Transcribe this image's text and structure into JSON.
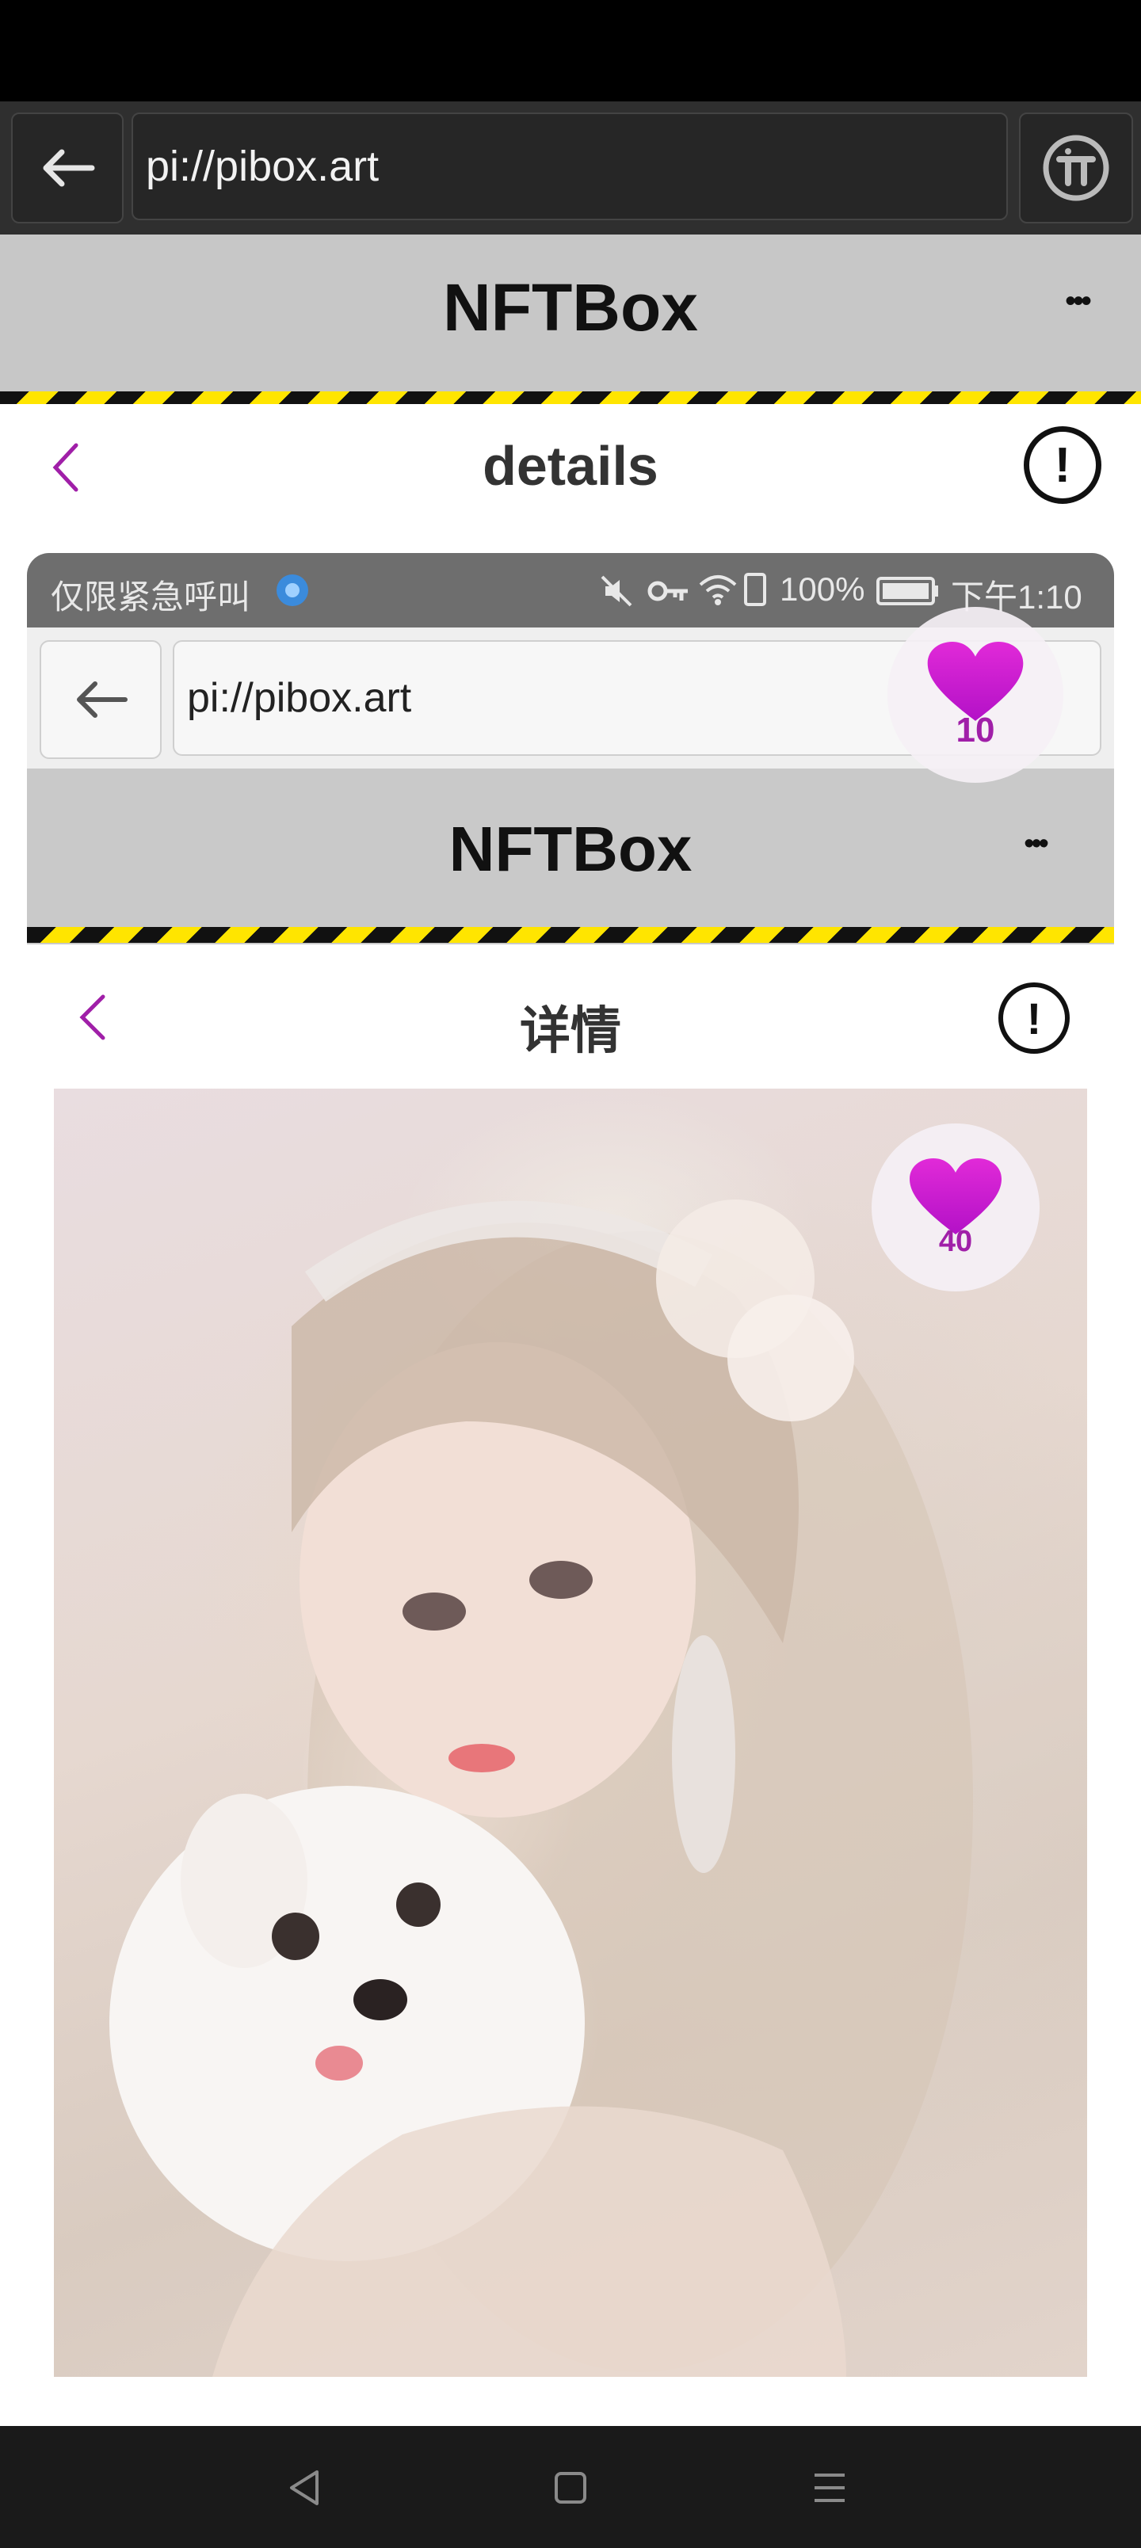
{
  "browser": {
    "url": "pi://pibox.art"
  },
  "app": {
    "title": "NFTBox",
    "menu_glyph": "•••"
  },
  "details": {
    "title": "details",
    "info_glyph": "!"
  },
  "inner": {
    "status_left": "仅限紧急呼叫",
    "status_right": "100%",
    "status_time": "下午1:10",
    "url": "pi://pibox.art",
    "app_title": "NFTBox",
    "menu_glyph": "•••",
    "details_title": "详情",
    "info_glyph": "!"
  },
  "likes": {
    "overlay_count": "10",
    "art_count": "40"
  },
  "colors": {
    "accent": "#a01fa8",
    "heart": "#d01bd6",
    "hazard_yellow": "#ffe500"
  },
  "icons": [
    "back-arrow-icon",
    "pi-logo-icon",
    "more-icon",
    "chevron-left-icon",
    "info-icon",
    "heart-icon",
    "mute-icon",
    "key-icon",
    "wifi-icon",
    "battery-icon",
    "nav-back-icon",
    "nav-home-icon",
    "nav-menu-icon"
  ]
}
